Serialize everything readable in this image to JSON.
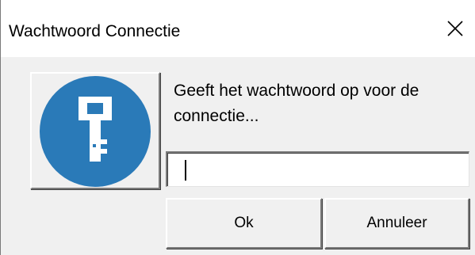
{
  "window": {
    "title": "Wachtwoord Connectie",
    "close_icon": "close-icon"
  },
  "dialog": {
    "icon": "key-icon",
    "icon_color": "#2a7ab8",
    "prompt": "Geeft het wachtwoord op voor de\nconnectie...",
    "password": {
      "value": "",
      "placeholder": ""
    }
  },
  "buttons": {
    "ok_label": "Ok",
    "cancel_label": "Annuleer"
  }
}
